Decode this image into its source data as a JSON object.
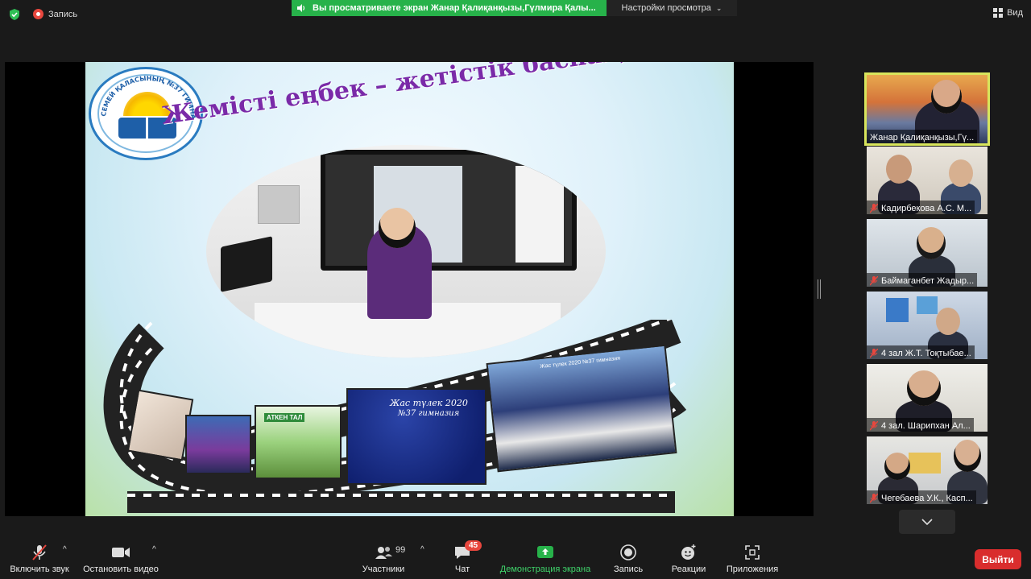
{
  "top_bar": {
    "recording_label": "Запись",
    "share_banner_text": "Вы  просматриваете экран Жанар Қалиқанқызы,Гүлмира Қалы...",
    "view_options_label": "Настройки просмотра",
    "view_button_label": "Вид"
  },
  "slide": {
    "title": "Жемісті еңбек – жетістік баспалдағы",
    "logo_text": "СЕМЕЙ ҚАЛАСЫНЫҢ №37 ГИМНАЗИЯСЫ КММ",
    "poster_text_1": "Жас түлек 2020",
    "poster_text_2": "№37 гимназия",
    "poster_text_3": "Жас түлек 2020 №37 гимназия",
    "sign_text": "АТКЕН ТАЛ"
  },
  "participants": [
    {
      "name": "Жанар Қалиқанқызы,Гү...",
      "active": true
    },
    {
      "name": "Кадирбекова А.С. М...",
      "muted": true
    },
    {
      "name": "Баймаганбет Жадыр...",
      "muted": true
    },
    {
      "name": "4 зал Ж.Т. Тоқтыбае...",
      "muted": true
    },
    {
      "name": "4 зал. Шарипхан Ал...",
      "muted": true
    },
    {
      "name": "Чегебаева У.К., Касп...",
      "muted": true
    }
  ],
  "toolbar": {
    "mute_label": "Включить звук",
    "video_label": "Остановить видео",
    "participants_label": "Участники",
    "participants_count": "99",
    "chat_label": "Чат",
    "chat_badge": "45",
    "share_label": "Демонстрация экрана",
    "record_label": "Запись",
    "reactions_label": "Реакции",
    "apps_label": "Приложения",
    "leave_label": "Выйти"
  },
  "colors": {
    "share_green": "#27b24a",
    "active_speaker_border": "#d8e55c",
    "leave_red": "#d92d2d",
    "title_purple": "#7a2aa8"
  }
}
